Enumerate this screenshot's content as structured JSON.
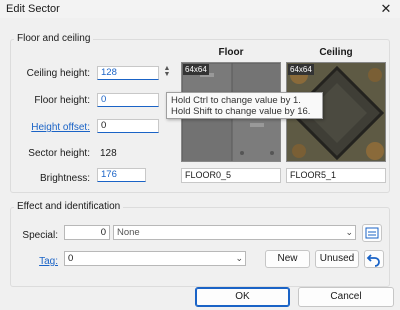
{
  "window": {
    "title": "Edit Sector",
    "close_glyph": "✕"
  },
  "floor_group": {
    "title": "Floor and ceiling",
    "ceiling_height": {
      "label": "Ceiling height:",
      "value": "128"
    },
    "floor_height": {
      "label": "Floor height:",
      "value": "0"
    },
    "height_offset": {
      "label": "Height offset:",
      "value": "0"
    },
    "sector_height": {
      "label": "Sector height:",
      "value": "128"
    },
    "brightness": {
      "label": "Brightness:",
      "value": "176"
    },
    "floor": {
      "header": "Floor",
      "size": "64x64",
      "name": "FLOOR0_5"
    },
    "ceiling": {
      "header": "Ceiling",
      "size": "64x64",
      "name": "FLOOR5_1"
    }
  },
  "tooltip": {
    "line1": "Hold Ctrl to change value by 1.",
    "line2": "Hold Shift to change value by 16."
  },
  "effect_group": {
    "title": "Effect and identification",
    "special_label": "Special:",
    "special_number": "0",
    "special_value": "None",
    "tag_label": "Tag:",
    "tag_value": "0",
    "new_label": "New",
    "unused_label": "Unused"
  },
  "buttons": {
    "ok": "OK",
    "cancel": "Cancel"
  },
  "icons": {
    "spin": "spin-arrows-icon",
    "browse": "browse-icon",
    "undo": "undo-icon"
  },
  "colors": {
    "accent": "#1a63c6",
    "background": "#f0f0f0"
  }
}
